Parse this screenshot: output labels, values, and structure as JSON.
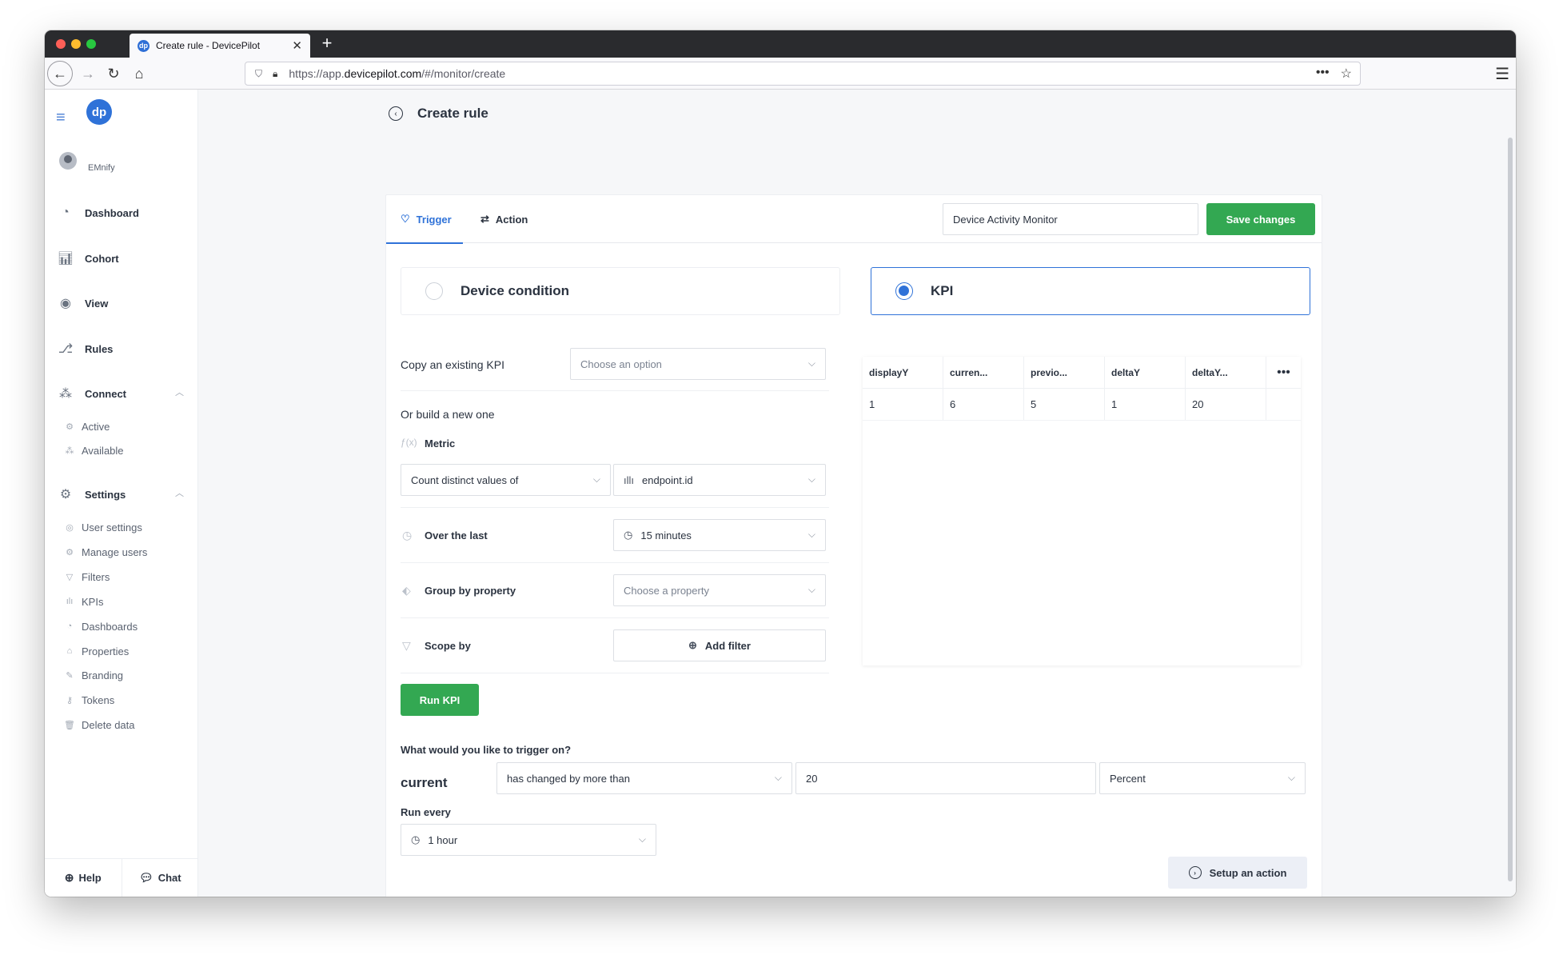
{
  "browser": {
    "tab_title": "Create rule - DevicePilot",
    "url_prefix": "https://app.",
    "url_domain": "devicepilot.com",
    "url_path": "/#/monitor/create"
  },
  "sidebar": {
    "user": "EMnify",
    "items": [
      {
        "label": "Dashboard"
      },
      {
        "label": "Cohort"
      },
      {
        "label": "View"
      },
      {
        "label": "Rules"
      },
      {
        "label": "Connect"
      },
      {
        "label": "Settings"
      }
    ],
    "connect_sub": [
      {
        "label": "Active"
      },
      {
        "label": "Available"
      }
    ],
    "settings_sub": [
      {
        "label": "User settings"
      },
      {
        "label": "Manage users"
      },
      {
        "label": "Filters"
      },
      {
        "label": "KPIs"
      },
      {
        "label": "Dashboards"
      },
      {
        "label": "Properties"
      },
      {
        "label": "Branding"
      },
      {
        "label": "Tokens"
      },
      {
        "label": "Delete data"
      }
    ],
    "footer": {
      "help": "Help",
      "chat": "Chat"
    }
  },
  "page": {
    "title": "Create rule"
  },
  "tabs": {
    "trigger": "Trigger",
    "action": "Action"
  },
  "rule_name": "Device Activity Monitor",
  "save_label": "Save changes",
  "trigger_type": {
    "device": "Device condition",
    "kpi": "KPI",
    "selected": "KPI"
  },
  "form": {
    "copy_label": "Copy an existing KPI",
    "copy_placeholder": "Choose an option",
    "build_label": "Or build a new one",
    "metric_label": "Metric",
    "metric_fn": "Count distinct values of",
    "metric_field": "endpoint.id",
    "over_label": "Over the last",
    "over_value": "15 minutes",
    "group_label": "Group by property",
    "group_placeholder": "Choose a property",
    "scope_label": "Scope by",
    "add_filter": "Add filter",
    "run_kpi": "Run KPI"
  },
  "table": {
    "headers": [
      "displayY",
      "curren...",
      "previo...",
      "deltaY",
      "deltaY..."
    ],
    "rows": [
      [
        "1",
        "6",
        "5",
        "1",
        "20"
      ]
    ]
  },
  "condition": {
    "question": "What would you like to trigger on?",
    "subject": "current",
    "operator": "has changed by more than",
    "value": "20",
    "unit": "Percent",
    "run_every_label": "Run every",
    "run_every_value": "1 hour"
  },
  "setup_action": "Setup an action"
}
